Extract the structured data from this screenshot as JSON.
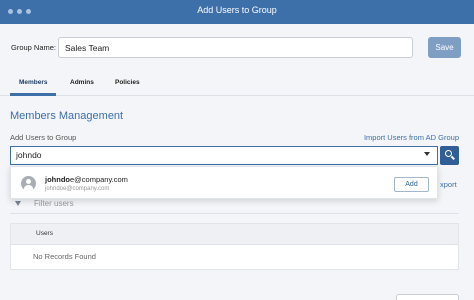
{
  "window": {
    "title": "Add Users to Group"
  },
  "group": {
    "label": "Group Name:",
    "name_value": "Sales Team",
    "save_label": "Save"
  },
  "tabs": [
    {
      "label": "Members",
      "active": true
    },
    {
      "label": "Admins",
      "active": false
    },
    {
      "label": "Policies",
      "active": false
    }
  ],
  "members": {
    "title": "Members Management",
    "add_label": "Add Users to Group",
    "import_link": "Import Users from AD Group",
    "search_value": "johndo",
    "export_link_partial": "xport",
    "filter_placeholder": "Filter users"
  },
  "suggestion": {
    "name_bold": "johndo",
    "name_rest": "e@company.com",
    "email": "johndoe@company.com",
    "add_label": "Add"
  },
  "table": {
    "columns": [
      "Users"
    ],
    "empty_text": "No Records Found"
  },
  "colors": {
    "accent": "#3d6fa8",
    "titlebar": "#3d6fa8",
    "save_button": "#7f9ec4"
  }
}
